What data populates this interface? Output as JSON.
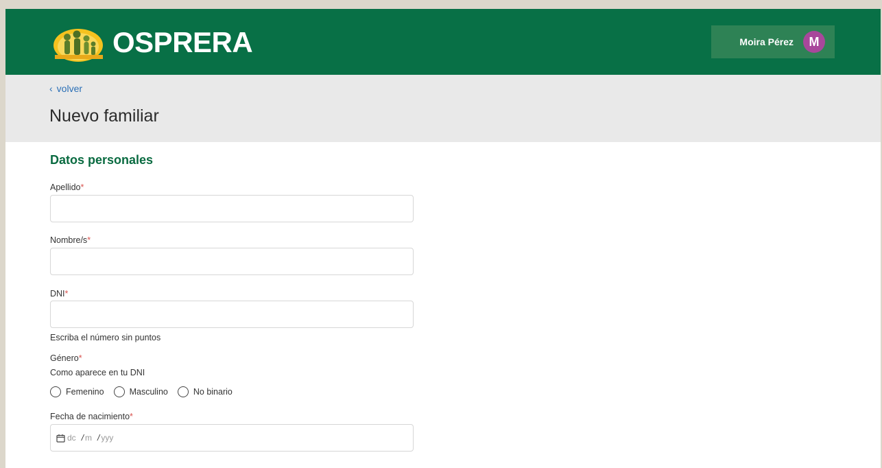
{
  "header": {
    "brand": "OSPRERA",
    "user_name": "Moira Pérez",
    "avatar_initial": "M",
    "colors": {
      "header_bg": "#087046",
      "avatar_bg": "#a8479b"
    }
  },
  "subheader": {
    "back_label": "volver",
    "title": "Nuevo familiar"
  },
  "form": {
    "section_title": "Datos personales",
    "apellido_label": "Apellido",
    "nombre_label": "Nombre/s",
    "dni_label": "DNI",
    "dni_help": "Escriba el número sin puntos",
    "genero_label": "Género",
    "genero_help": "Como aparece en tu DNI",
    "genero_options": [
      "Femenino",
      "Masculino",
      "No binario"
    ],
    "fecha_label": "Fecha de nacimiento",
    "fecha_placeholder": {
      "day": "dc",
      "month": "m",
      "year": "yyy"
    },
    "required_mark": "*"
  }
}
